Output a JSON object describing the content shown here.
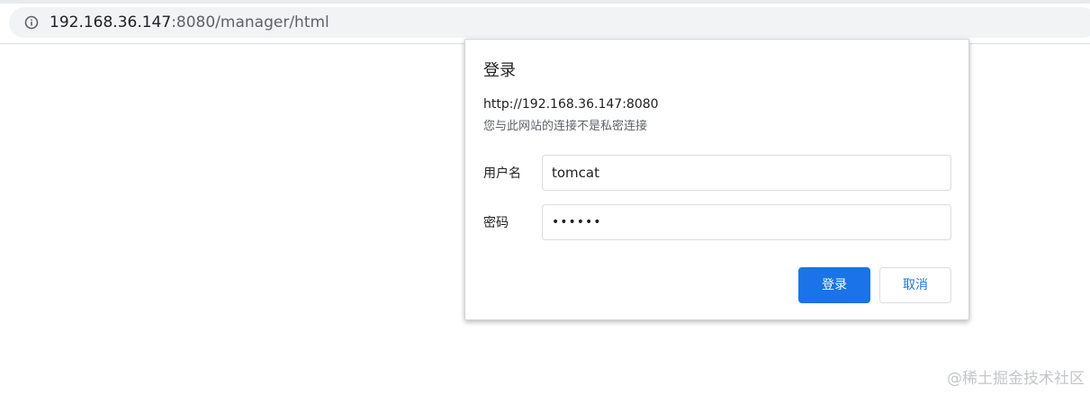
{
  "browser": {
    "url_host": "192.168.36.147",
    "url_rest": ":8080/manager/html"
  },
  "dialog": {
    "title": "登录",
    "origin": "http://192.168.36.147:8080",
    "warning": "您与此网站的连接不是私密连接",
    "username_label": "用户名",
    "username_value": "tomcat",
    "password_label": "密码",
    "password_value": "••••••",
    "login_label": "登录",
    "cancel_label": "取消"
  },
  "watermark": "@稀土掘金技术社区",
  "colors": {
    "accent": "#1a73e8",
    "addressbar_bg": "#f1f3f4"
  },
  "icons": {
    "info": "info-icon"
  }
}
